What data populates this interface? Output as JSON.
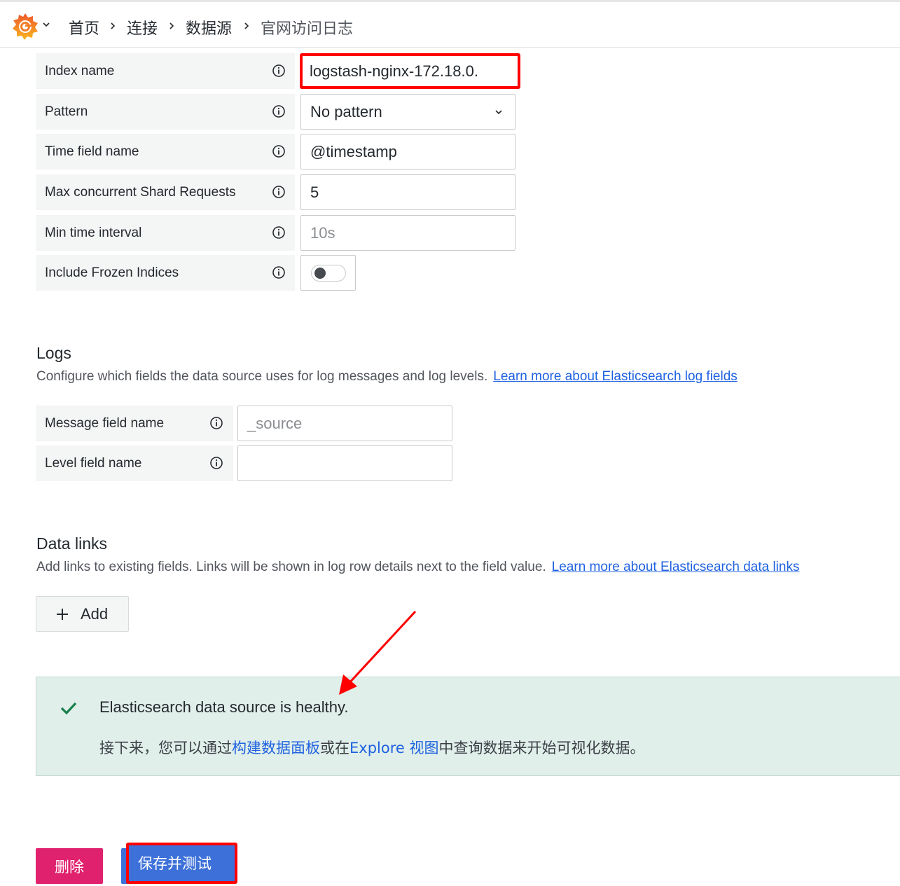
{
  "breadcrumb": {
    "items": [
      "首页",
      "连接",
      "数据源",
      "官网访问日志"
    ]
  },
  "icons": {
    "logo": "grafana-logo-icon",
    "info": "info-circle-icon",
    "chevron": "chevron-down-icon",
    "check": "check-icon",
    "plus": "plus-icon"
  },
  "settings": {
    "index_name": {
      "label": "Index name",
      "value": "logstash-nginx-172.18.0."
    },
    "pattern": {
      "label": "Pattern",
      "value": "No pattern"
    },
    "time_field": {
      "label": "Time field name",
      "value": "@timestamp"
    },
    "max_shard": {
      "label": "Max concurrent Shard Requests",
      "value": "5"
    },
    "min_interval": {
      "label": "Min time interval",
      "placeholder": "10s"
    },
    "frozen": {
      "label": "Include Frozen Indices",
      "on": false
    }
  },
  "logs": {
    "title": "Logs",
    "description": "Configure which fields the data source uses for log messages and log levels.",
    "link": "Learn more about Elasticsearch log fields",
    "message_field": {
      "label": "Message field name",
      "placeholder": "_source"
    },
    "level_field": {
      "label": "Level field name",
      "value": ""
    }
  },
  "data_links": {
    "title": "Data links",
    "description": "Add links to existing fields. Links will be shown in log row details next to the field value.",
    "link": "Learn more about Elasticsearch data links",
    "add_label": "Add"
  },
  "alert": {
    "title": "Elasticsearch data source is healthy.",
    "msg_prefix": "接下来，您可以通过",
    "link_dashboard": "构建数据面板",
    "msg_mid": "或在",
    "link_explore": "Explore 视图",
    "msg_suffix": "中查询数据来开始可视化数据。"
  },
  "actions": {
    "delete_label": "删除",
    "save_label": "保存并测试"
  },
  "colors": {
    "annotation_red": "#ff0000",
    "primary_blue": "#3d71d9",
    "destructive_pink": "#e0226e",
    "success_green": "#1a7f4b",
    "link_blue": "#1f62e0"
  }
}
